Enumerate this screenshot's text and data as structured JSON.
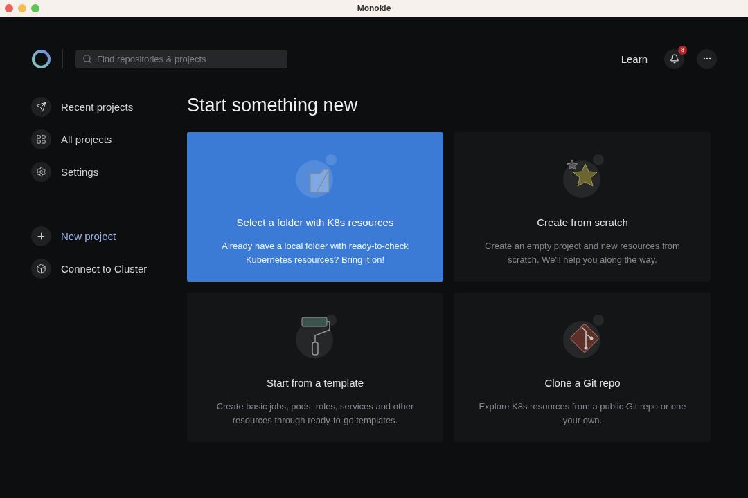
{
  "window": {
    "title": "Monokle"
  },
  "header": {
    "search": {
      "placeholder": "Find repositories & projects"
    },
    "learn": "Learn",
    "notifications": {
      "count": "8"
    }
  },
  "sidebar": {
    "groups": [
      [
        {
          "kind": "send",
          "label": "Recent projects",
          "highlighted": false
        },
        {
          "kind": "grid",
          "label": "All projects",
          "highlighted": false
        },
        {
          "kind": "gear",
          "label": "Settings",
          "highlighted": false
        }
      ],
      [
        {
          "kind": "plus",
          "label": "New project",
          "highlighted": true
        },
        {
          "kind": "cube",
          "label": "Connect to Cluster",
          "highlighted": false
        }
      ]
    ]
  },
  "main": {
    "title": "Start something new",
    "cards": [
      {
        "kind": "folder",
        "title": "Select a folder with K8s resources",
        "description": "Already have a local folder with ready-to-check Kubernetes resources? Bring it on!",
        "selected": true
      },
      {
        "kind": "star",
        "title": "Create from scratch",
        "description": "Create an empty project and new resources from scratch. We'll help you along the way.",
        "selected": false
      },
      {
        "kind": "roller",
        "title": "Start from a template",
        "description": "Create basic jobs, pods, roles, services and other resources through ready-to-go templates.",
        "selected": false
      },
      {
        "kind": "git",
        "title": "Clone a Git repo",
        "description": "Explore K8s resources from a public Git repo or one your own.",
        "selected": false
      }
    ]
  }
}
